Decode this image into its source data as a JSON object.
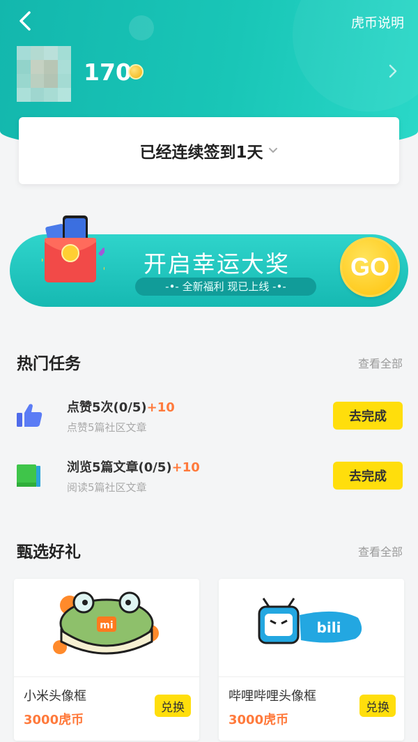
{
  "header": {
    "back_icon": "chevron-left-icon",
    "help_label": "虎币说明",
    "coin_balance": "170",
    "coin_icon": "coin-icon",
    "profile_chevron": "chevron-right-icon",
    "gradient_start": "#13b7ad",
    "gradient_end": "#2ad8c8"
  },
  "signin": {
    "text": "已经连续签到1天",
    "expand_icon": "chevron-down-icon"
  },
  "banner": {
    "title": "开启幸运大奖",
    "subtitle": "-•- 全新福利 现已上线 -•-",
    "go_label": "GO",
    "go_color": "#ffc20a"
  },
  "hot_tasks": {
    "title": "热门任务",
    "view_all": "查看全部",
    "items": [
      {
        "title": "点赞5次(0/5)",
        "bonus": "+10",
        "desc": "点赞5篇社区文章",
        "button": "去完成",
        "icon": "thumbs-up-icon"
      },
      {
        "title": "浏览5篇文章(0/5)",
        "bonus": "+10",
        "desc": "阅读5篇社区文章",
        "button": "去完成",
        "icon": "book-icon"
      }
    ]
  },
  "gifts": {
    "title": "甄选好礼",
    "view_all": "查看全部",
    "items": [
      {
        "name": "小米头像框",
        "price": "3000虎币",
        "button": "兑换",
        "image": "xiaomi-frame-image"
      },
      {
        "name": "哔哩哔哩头像框",
        "price": "3000虎币",
        "button": "兑换",
        "image": "bilibili-frame-image"
      }
    ]
  },
  "colors": {
    "accent_yellow": "#ffde0c",
    "bonus_orange": "#ff7a3c",
    "teal": "#19c6b7"
  }
}
